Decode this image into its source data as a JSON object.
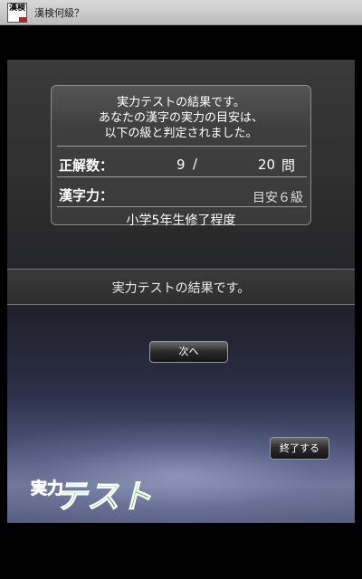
{
  "app": {
    "icon_text": "漢検",
    "title": "漢検何級？"
  },
  "result": {
    "message_lines": [
      "実力テストの結果です。",
      "あなたの漢字の実力の目安は、",
      "以下の級と判定されました。"
    ],
    "correct_label": "正解数：",
    "correct_count": "9",
    "separator": "/",
    "total_count": "20",
    "count_unit": "問",
    "kanji_label": "漢字力：",
    "grade": "目安６級",
    "grade_level": "小学5年生修了程度"
  },
  "info": {
    "text": "実力テストの結果です。"
  },
  "buttons": {
    "next": "次へ",
    "end": "終了する"
  },
  "logo": {
    "text_small": "実力",
    "text_large": "テスト"
  },
  "colors": {
    "logo_green": "#22c033",
    "background": "#000000"
  }
}
